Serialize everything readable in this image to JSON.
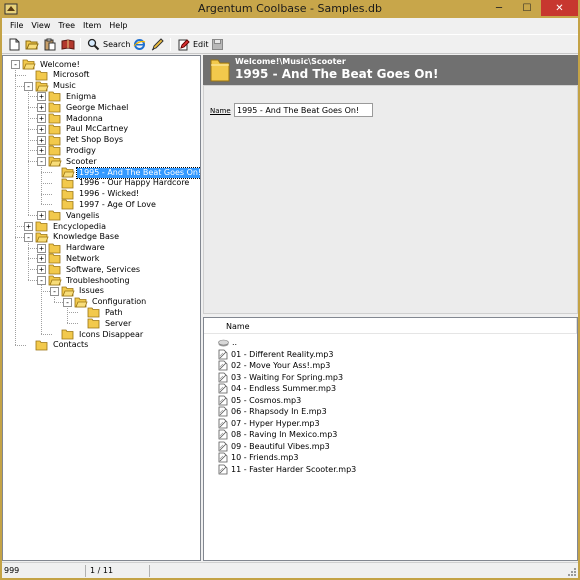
{
  "window": {
    "title": "Argentum Coolbase - Samples.db"
  },
  "titlebar_buttons": {
    "minimize": "─",
    "maximize": "☐",
    "close": "✕"
  },
  "menu": [
    "File",
    "View",
    "Tree",
    "Item",
    "Help"
  ],
  "toolbar": {
    "search_label": "Search",
    "edit_label": "Edit"
  },
  "tree": [
    {
      "label": "Welcome!",
      "level": 0,
      "expander": "-"
    },
    {
      "label": "Microsoft",
      "level": 1,
      "expander": ""
    },
    {
      "label": "Music",
      "level": 1,
      "expander": "-"
    },
    {
      "label": "Enigma",
      "level": 2,
      "expander": "+"
    },
    {
      "label": "George Michael",
      "level": 2,
      "expander": "+"
    },
    {
      "label": "Madonna",
      "level": 2,
      "expander": "+"
    },
    {
      "label": "Paul McCartney",
      "level": 2,
      "expander": "+"
    },
    {
      "label": "Pet Shop Boys",
      "level": 2,
      "expander": "+"
    },
    {
      "label": "Prodigy",
      "level": 2,
      "expander": "+"
    },
    {
      "label": "Scooter",
      "level": 2,
      "expander": "-"
    },
    {
      "label": "1995 - And The Beat Goes On!",
      "level": 3,
      "expander": "",
      "selected": true
    },
    {
      "label": "1996 - Our Happy Hardcore",
      "level": 3,
      "expander": ""
    },
    {
      "label": "1996 - Wicked!",
      "level": 3,
      "expander": ""
    },
    {
      "label": "1997 - Age Of Love",
      "level": 3,
      "expander": ""
    },
    {
      "label": "Vangelis",
      "level": 2,
      "expander": "+"
    },
    {
      "label": "Encyclopedia",
      "level": 1,
      "expander": "+"
    },
    {
      "label": "Knowledge Base",
      "level": 1,
      "expander": "-"
    },
    {
      "label": "Hardware",
      "level": 2,
      "expander": "+"
    },
    {
      "label": "Network",
      "level": 2,
      "expander": "+"
    },
    {
      "label": "Software, Services",
      "level": 2,
      "expander": "+"
    },
    {
      "label": "Troubleshooting",
      "level": 2,
      "expander": "-"
    },
    {
      "label": "Issues",
      "level": 3,
      "expander": "-"
    },
    {
      "label": "Configuration",
      "level": 4,
      "expander": "-"
    },
    {
      "label": "Path",
      "level": 5,
      "expander": ""
    },
    {
      "label": "Server",
      "level": 5,
      "expander": ""
    },
    {
      "label": "Icons Disappear",
      "level": 3,
      "expander": ""
    },
    {
      "label": "Contacts",
      "level": 1,
      "expander": ""
    }
  ],
  "header": {
    "path": "Welcome!\\Music\\Scooter",
    "title": "1995 - And The Beat Goes On!"
  },
  "properties": {
    "name_label": "Name",
    "name_value": "1995 - And The Beat Goes On!"
  },
  "filelist": {
    "column_name": "Name",
    "items": [
      {
        "label": "..",
        "icon": "up-folder-icon"
      },
      {
        "label": "01 - Different Reality.mp3",
        "icon": "file-link-icon"
      },
      {
        "label": "02 - Move Your Ass!.mp3",
        "icon": "file-link-icon"
      },
      {
        "label": "03 - Waiting For Spring.mp3",
        "icon": "file-link-icon"
      },
      {
        "label": "04 - Endless Summer.mp3",
        "icon": "file-link-icon"
      },
      {
        "label": "05 - Cosmos.mp3",
        "icon": "file-link-icon"
      },
      {
        "label": "06 - Rhapsody In E.mp3",
        "icon": "file-link-icon"
      },
      {
        "label": "07 - Hyper Hyper.mp3",
        "icon": "file-link-icon"
      },
      {
        "label": "08 - Raving In Mexico.mp3",
        "icon": "file-link-icon"
      },
      {
        "label": "09 - Beautiful Vibes.mp3",
        "icon": "file-link-icon"
      },
      {
        "label": "10 - Friends.mp3",
        "icon": "file-link-icon"
      },
      {
        "label": "11 - Faster Harder Scooter.mp3",
        "icon": "file-link-icon"
      }
    ]
  },
  "status": {
    "count": "999",
    "position": "1 / 11"
  },
  "colors": {
    "titlebar": "#c8a64a",
    "close": "#c7372f",
    "header_bg": "#707070",
    "selection": "#3399ff",
    "folder": "#f2c94c"
  }
}
